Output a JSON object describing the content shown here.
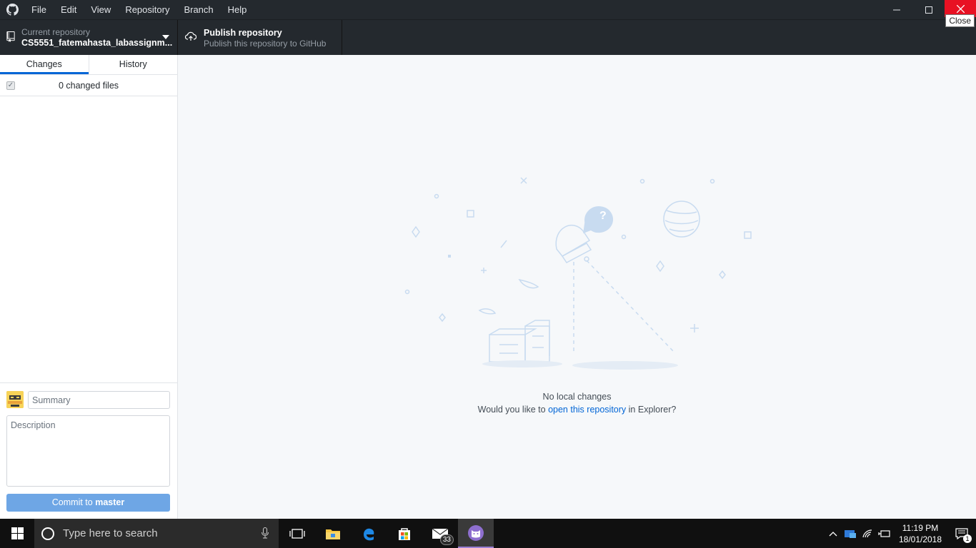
{
  "menu": {
    "items": [
      "File",
      "Edit",
      "View",
      "Repository",
      "Branch",
      "Help"
    ]
  },
  "window": {
    "close_tooltip": "Close"
  },
  "toolbar": {
    "repo_label": "Current repository",
    "repo_name": "CS5551_fatemahasta_labassignm...",
    "publish_title": "Publish repository",
    "publish_subtitle": "Publish this repository to GitHub"
  },
  "sidebar": {
    "tabs": [
      "Changes",
      "History"
    ],
    "changed_files": "0 changed files",
    "summary_placeholder": "Summary",
    "description_placeholder": "Description",
    "commit_prefix": "Commit to",
    "commit_branch": "master"
  },
  "main": {
    "title": "No local changes",
    "prompt_before": "Would you like to",
    "prompt_link": "open this repository",
    "prompt_after": "in Explorer?"
  },
  "taskbar": {
    "search_placeholder": "Type here to search",
    "mail_badge": "33",
    "time": "11:19 PM",
    "date": "18/01/2018",
    "notifications": "1"
  },
  "colors": {
    "accent": "#0366d6",
    "titlebar": "#24292e",
    "close_red": "#e81123",
    "commit_button": "#6ea6e5"
  }
}
